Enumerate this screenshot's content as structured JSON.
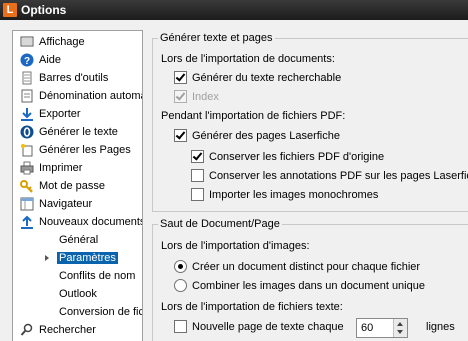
{
  "window": {
    "title": "Options",
    "app_letter": "L"
  },
  "nav": {
    "items": [
      {
        "label": "Affichage"
      },
      {
        "label": "Aide"
      },
      {
        "label": "Barres d'outils"
      },
      {
        "label": "Dénomination automa"
      },
      {
        "label": "Exporter"
      },
      {
        "label": "Générer le texte"
      },
      {
        "label": "Générer les Pages"
      },
      {
        "label": "Imprimer"
      },
      {
        "label": "Mot de passe"
      },
      {
        "label": "Navigateur"
      },
      {
        "label": "Nouveaux documents"
      },
      {
        "label": "Général"
      },
      {
        "label": "Paramètres"
      },
      {
        "label": "Conflits de nom"
      },
      {
        "label": "Outlook"
      },
      {
        "label": "Conversion de fic"
      },
      {
        "label": "Rechercher"
      }
    ]
  },
  "gen_text": {
    "legend": "Générer texte et pages",
    "import_docs_label": "Lors de l'importation de documents:",
    "searchable_text": {
      "label": "Générer du texte recherchable",
      "checked": true
    },
    "index": {
      "label": "Index",
      "checked": true,
      "disabled": true
    },
    "pdf_import_label": "Pendant l'importation de fichiers PDF:",
    "laserfiche_pages": {
      "label": "Générer des pages Laserfiche",
      "checked": true
    },
    "keep_original_pdf": {
      "label": "Conserver les fichiers PDF d'origine",
      "checked": true
    },
    "keep_annotations": {
      "label": "Conserver les annotations PDF sur les pages Laserfiche",
      "checked": false
    },
    "import_mono": {
      "label": "Importer les images monochromes",
      "checked": false
    }
  },
  "page_break": {
    "legend": "Saut de Document/Page",
    "images_label": "Lors de l'importation d'images:",
    "separate_doc": {
      "label": "Créer un document distinct pour chaque fichier",
      "checked": true
    },
    "combine_images": {
      "label": "Combiner les images dans un document unique",
      "checked": false
    },
    "text_files_label": "Lors de l'importation de fichiers texte:",
    "new_page_each": {
      "label": "Nouvelle page de texte chaque",
      "checked": false
    },
    "lines_value": "60",
    "lines_unit": "lignes"
  }
}
